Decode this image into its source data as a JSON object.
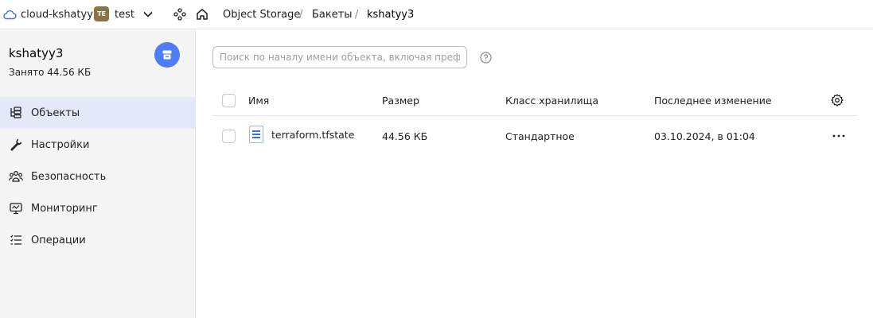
{
  "topbar": {
    "cloud_name": "cloud-kshatyy",
    "folder_badge": "TE",
    "folder_name": "test",
    "breadcrumbs": [
      "Object Storage",
      "Бакеты",
      "kshatyy3"
    ],
    "separator": "/"
  },
  "sidebar": {
    "bucket_name": "kshatyy3",
    "used": "Занято 44.56 КБ",
    "items": [
      {
        "label": "Объекты",
        "icon": "objects-icon",
        "active": true
      },
      {
        "label": "Настройки",
        "icon": "wrench-icon",
        "active": false
      },
      {
        "label": "Безопасность",
        "icon": "users-icon",
        "active": false
      },
      {
        "label": "Мониторинг",
        "icon": "monitor-icon",
        "active": false
      },
      {
        "label": "Операции",
        "icon": "list-icon",
        "active": false
      }
    ]
  },
  "search": {
    "placeholder": "Поиск по началу имени объекта, включая префикс",
    "value": ""
  },
  "table": {
    "columns": [
      "Имя",
      "Размер",
      "Класс хранилища",
      "Последнее изменение"
    ],
    "rows": [
      {
        "name": "terraform.tfstate",
        "size": "44.56 КБ",
        "storage_class": "Стандартное",
        "modified": "03.10.2024, в 01:04"
      }
    ]
  },
  "colors": {
    "accent": "#4f7df9",
    "active_nav": "#e4e9f9",
    "folder_badge": "#8a7346"
  }
}
